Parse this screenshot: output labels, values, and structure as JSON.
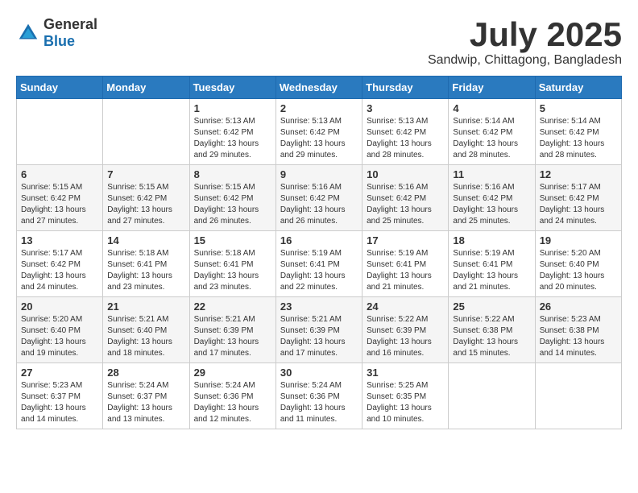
{
  "header": {
    "logo_general": "General",
    "logo_blue": "Blue",
    "month_year": "July 2025",
    "location": "Sandwip, Chittagong, Bangladesh"
  },
  "weekdays": [
    "Sunday",
    "Monday",
    "Tuesday",
    "Wednesday",
    "Thursday",
    "Friday",
    "Saturday"
  ],
  "weeks": [
    [
      {
        "day": "",
        "info": ""
      },
      {
        "day": "",
        "info": ""
      },
      {
        "day": "1",
        "info": "Sunrise: 5:13 AM\nSunset: 6:42 PM\nDaylight: 13 hours and 29 minutes."
      },
      {
        "day": "2",
        "info": "Sunrise: 5:13 AM\nSunset: 6:42 PM\nDaylight: 13 hours and 29 minutes."
      },
      {
        "day": "3",
        "info": "Sunrise: 5:13 AM\nSunset: 6:42 PM\nDaylight: 13 hours and 28 minutes."
      },
      {
        "day": "4",
        "info": "Sunrise: 5:14 AM\nSunset: 6:42 PM\nDaylight: 13 hours and 28 minutes."
      },
      {
        "day": "5",
        "info": "Sunrise: 5:14 AM\nSunset: 6:42 PM\nDaylight: 13 hours and 28 minutes."
      }
    ],
    [
      {
        "day": "6",
        "info": "Sunrise: 5:15 AM\nSunset: 6:42 PM\nDaylight: 13 hours and 27 minutes."
      },
      {
        "day": "7",
        "info": "Sunrise: 5:15 AM\nSunset: 6:42 PM\nDaylight: 13 hours and 27 minutes."
      },
      {
        "day": "8",
        "info": "Sunrise: 5:15 AM\nSunset: 6:42 PM\nDaylight: 13 hours and 26 minutes."
      },
      {
        "day": "9",
        "info": "Sunrise: 5:16 AM\nSunset: 6:42 PM\nDaylight: 13 hours and 26 minutes."
      },
      {
        "day": "10",
        "info": "Sunrise: 5:16 AM\nSunset: 6:42 PM\nDaylight: 13 hours and 25 minutes."
      },
      {
        "day": "11",
        "info": "Sunrise: 5:16 AM\nSunset: 6:42 PM\nDaylight: 13 hours and 25 minutes."
      },
      {
        "day": "12",
        "info": "Sunrise: 5:17 AM\nSunset: 6:42 PM\nDaylight: 13 hours and 24 minutes."
      }
    ],
    [
      {
        "day": "13",
        "info": "Sunrise: 5:17 AM\nSunset: 6:42 PM\nDaylight: 13 hours and 24 minutes."
      },
      {
        "day": "14",
        "info": "Sunrise: 5:18 AM\nSunset: 6:41 PM\nDaylight: 13 hours and 23 minutes."
      },
      {
        "day": "15",
        "info": "Sunrise: 5:18 AM\nSunset: 6:41 PM\nDaylight: 13 hours and 23 minutes."
      },
      {
        "day": "16",
        "info": "Sunrise: 5:19 AM\nSunset: 6:41 PM\nDaylight: 13 hours and 22 minutes."
      },
      {
        "day": "17",
        "info": "Sunrise: 5:19 AM\nSunset: 6:41 PM\nDaylight: 13 hours and 21 minutes."
      },
      {
        "day": "18",
        "info": "Sunrise: 5:19 AM\nSunset: 6:41 PM\nDaylight: 13 hours and 21 minutes."
      },
      {
        "day": "19",
        "info": "Sunrise: 5:20 AM\nSunset: 6:40 PM\nDaylight: 13 hours and 20 minutes."
      }
    ],
    [
      {
        "day": "20",
        "info": "Sunrise: 5:20 AM\nSunset: 6:40 PM\nDaylight: 13 hours and 19 minutes."
      },
      {
        "day": "21",
        "info": "Sunrise: 5:21 AM\nSunset: 6:40 PM\nDaylight: 13 hours and 18 minutes."
      },
      {
        "day": "22",
        "info": "Sunrise: 5:21 AM\nSunset: 6:39 PM\nDaylight: 13 hours and 17 minutes."
      },
      {
        "day": "23",
        "info": "Sunrise: 5:21 AM\nSunset: 6:39 PM\nDaylight: 13 hours and 17 minutes."
      },
      {
        "day": "24",
        "info": "Sunrise: 5:22 AM\nSunset: 6:39 PM\nDaylight: 13 hours and 16 minutes."
      },
      {
        "day": "25",
        "info": "Sunrise: 5:22 AM\nSunset: 6:38 PM\nDaylight: 13 hours and 15 minutes."
      },
      {
        "day": "26",
        "info": "Sunrise: 5:23 AM\nSunset: 6:38 PM\nDaylight: 13 hours and 14 minutes."
      }
    ],
    [
      {
        "day": "27",
        "info": "Sunrise: 5:23 AM\nSunset: 6:37 PM\nDaylight: 13 hours and 14 minutes."
      },
      {
        "day": "28",
        "info": "Sunrise: 5:24 AM\nSunset: 6:37 PM\nDaylight: 13 hours and 13 minutes."
      },
      {
        "day": "29",
        "info": "Sunrise: 5:24 AM\nSunset: 6:36 PM\nDaylight: 13 hours and 12 minutes."
      },
      {
        "day": "30",
        "info": "Sunrise: 5:24 AM\nSunset: 6:36 PM\nDaylight: 13 hours and 11 minutes."
      },
      {
        "day": "31",
        "info": "Sunrise: 5:25 AM\nSunset: 6:35 PM\nDaylight: 13 hours and 10 minutes."
      },
      {
        "day": "",
        "info": ""
      },
      {
        "day": "",
        "info": ""
      }
    ]
  ]
}
